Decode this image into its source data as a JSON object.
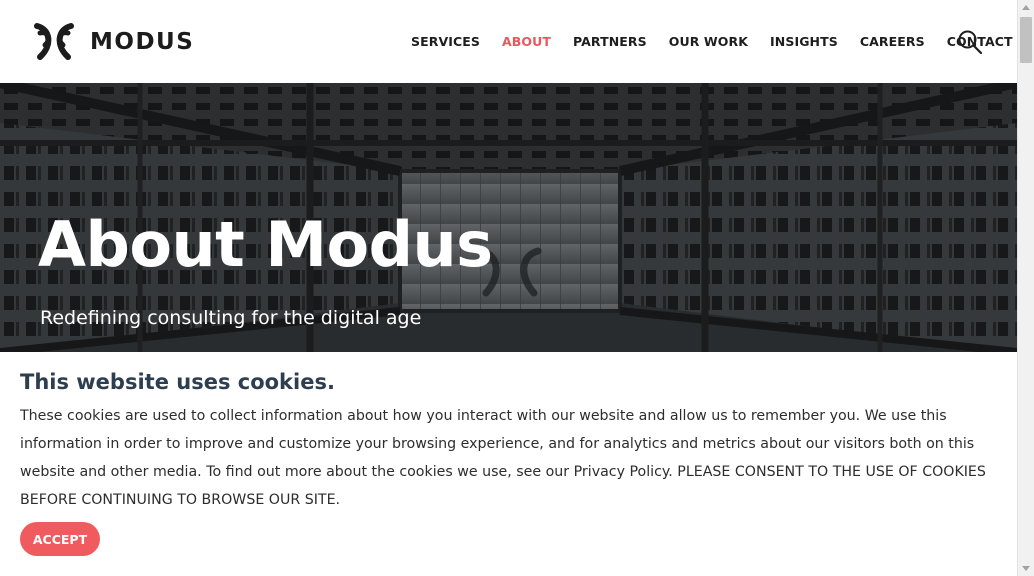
{
  "header": {
    "logo_text": "MODUS",
    "logo_icon": "modus-logo-mark",
    "search_icon": "search-icon"
  },
  "nav": {
    "items": [
      {
        "label": "SERVICES",
        "active": false
      },
      {
        "label": "ABOUT",
        "active": true
      },
      {
        "label": "PARTNERS",
        "active": false
      },
      {
        "label": "OUR WORK",
        "active": false
      },
      {
        "label": "INSIGHTS",
        "active": false
      },
      {
        "label": "CAREERS",
        "active": false
      },
      {
        "label": "CONTACT",
        "active": false
      }
    ]
  },
  "hero": {
    "title": "About Modus",
    "subtitle": "Redefining consulting for the digital age"
  },
  "cookie": {
    "title": "This website uses cookies.",
    "text": "These cookies are used to collect information about how you interact with our website and allow us to remember you. We use this information in order to improve and customize your browsing experience, and for analytics and metrics about our visitors both on this website and other media. To find out more about the cookies we use, see our Privacy Policy. PLEASE CONSENT TO THE USE OF COOKIES BEFORE CONTINUING TO BROWSE OUR SITE.",
    "accept_label": "ACCEPT"
  },
  "colors": {
    "accent": "#ef5b5f",
    "active_nav": "#e8585e",
    "heading": "#2c3e50",
    "text": "#2d2d2d"
  }
}
